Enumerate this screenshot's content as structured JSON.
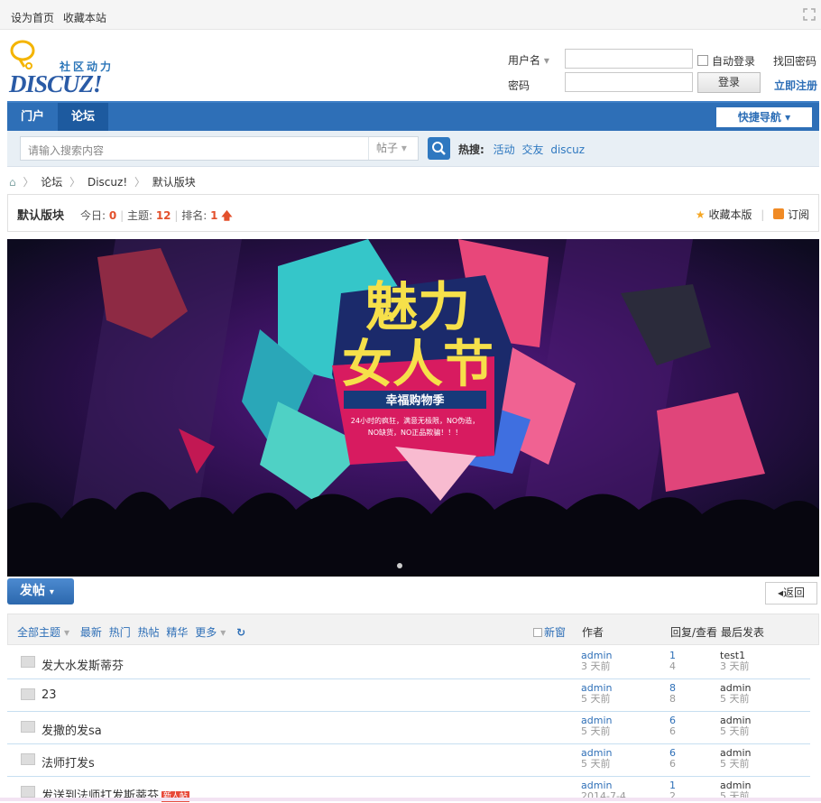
{
  "topbar": {
    "set_home": "设为首页",
    "bookmark": "收藏本站"
  },
  "logo": {
    "slogan": "社区动力",
    "brand": "DISCUZ!"
  },
  "login": {
    "username_label": "用户名",
    "password_label": "密码",
    "auto_login": "自动登录",
    "find_password": "找回密码",
    "login_button": "登录",
    "register": "立即注册"
  },
  "nav": {
    "items": [
      "门户",
      "论坛"
    ],
    "quick_nav": "快捷导航"
  },
  "search": {
    "placeholder": "请输入搜索内容",
    "type": "帖子",
    "hot_label": "热搜:",
    "hot_terms": [
      "活动",
      "交友",
      "discuz"
    ]
  },
  "breadcrumb": [
    "论坛",
    "Discuz!",
    "默认版块"
  ],
  "forum": {
    "name": "默认版块",
    "today_label": "今日:",
    "today": "0",
    "topics_label": "主题:",
    "topics": "12",
    "rank_label": "排名:",
    "rank": "1",
    "favorite": "收藏本版",
    "subscribe": "订阅"
  },
  "banner": {
    "line1": "魅力",
    "line2": "女人节",
    "ribbon": "幸福购物季",
    "promo1": "24小时的疯狂，满意无极限，NO伪造，",
    "promo2": "NO缺货，NO正品欺骗！！！"
  },
  "actions": {
    "post": "发帖",
    "back": "返回"
  },
  "list_header": {
    "filters": [
      "全部主题",
      "最新",
      "热门",
      "热帖",
      "精华",
      "更多"
    ],
    "new_window": "新窗",
    "author_col": "作者",
    "replies_col": "回复/查看",
    "last_col": "最后发表"
  },
  "threads": [
    {
      "title": "发大水发斯蒂芬",
      "author": "admin",
      "time": "3 天前",
      "replies": "1",
      "views": "4",
      "last_user": "test1",
      "last_time": "3 天前"
    },
    {
      "title": "23",
      "author": "admin",
      "time": "5 天前",
      "replies": "8",
      "views": "8",
      "last_user": "admin",
      "last_time": "5 天前"
    },
    {
      "title": "发撒的发sa",
      "author": "admin",
      "time": "5 天前",
      "replies": "6",
      "views": "6",
      "last_user": "admin",
      "last_time": "5 天前"
    },
    {
      "title": "法师打发s",
      "author": "admin",
      "time": "5 天前",
      "replies": "6",
      "views": "6",
      "last_user": "admin",
      "last_time": "5 天前"
    },
    {
      "title": "发送到法师打发斯蒂芬",
      "badge": "新人帖",
      "author": "admin",
      "time": "2014-7-4",
      "replies": "1",
      "views": "2",
      "last_user": "admin",
      "last_time": "5 天前"
    }
  ],
  "colors": {
    "brand_blue": "#2e6fb7",
    "accent_red": "#e3502c"
  }
}
